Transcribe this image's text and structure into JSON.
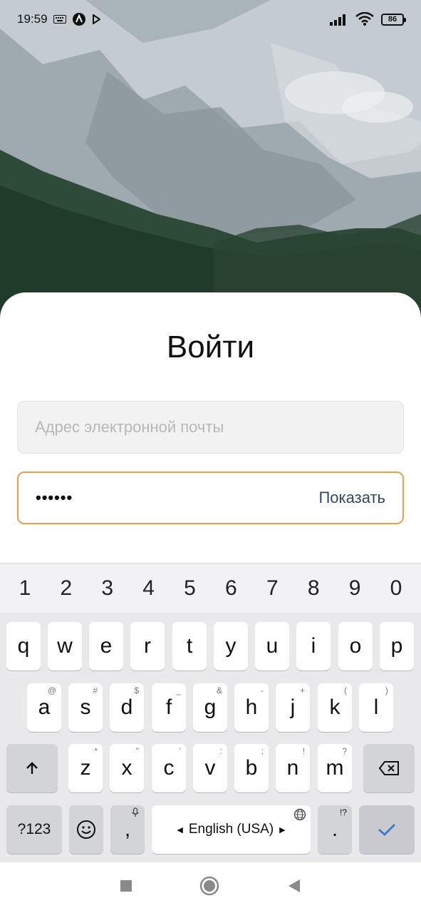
{
  "status_bar": {
    "time": "19:59",
    "battery": "86",
    "icons": [
      "keyboard-icon",
      "app-a-icon",
      "play-icon",
      "signal-icon",
      "wifi-icon",
      "battery-icon"
    ]
  },
  "login": {
    "title": "Войти",
    "email_placeholder": "Адрес электронной почты",
    "email_value": "",
    "password_value": "••••••",
    "show_password_label": "Показать"
  },
  "keyboard": {
    "number_row": [
      "1",
      "2",
      "3",
      "4",
      "5",
      "6",
      "7",
      "8",
      "9",
      "0"
    ],
    "row1": [
      "q",
      "w",
      "e",
      "r",
      "t",
      "y",
      "u",
      "i",
      "o",
      "p"
    ],
    "row2": [
      "a",
      "s",
      "d",
      "f",
      "g",
      "h",
      "j",
      "k",
      "l"
    ],
    "row2_hints": [
      "@",
      "#",
      "$",
      "_",
      "&",
      "-",
      "+",
      "(",
      ")"
    ],
    "row3": [
      "z",
      "x",
      "c",
      "v",
      "b",
      "n",
      "m"
    ],
    "row3_hints": [
      "*",
      "\"",
      "'",
      ":",
      ";",
      "!",
      "?"
    ],
    "symbols_key": "?123",
    "comma": ",",
    "space_label": "English (USA)",
    "period": ".",
    "period_hint": "!?",
    "accent_color": "#3a78c9"
  },
  "colors": {
    "password_border": "#e8a04a",
    "show_button": "#2f4a5c"
  }
}
